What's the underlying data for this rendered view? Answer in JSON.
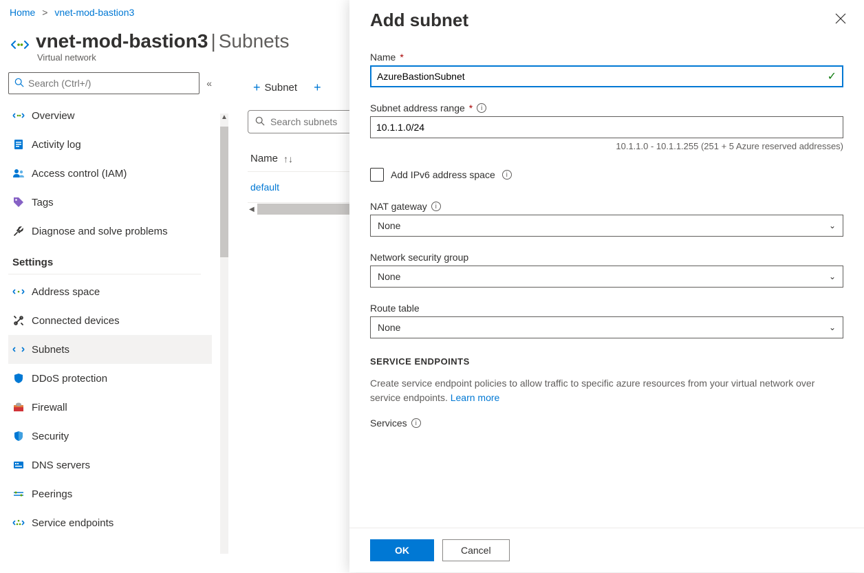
{
  "breadcrumb": {
    "home": "Home",
    "current": "vnet-mod-bastion3"
  },
  "header": {
    "title": "vnet-mod-bastion3",
    "section": "Subnets",
    "subtitle": "Virtual network"
  },
  "sidebar": {
    "search_placeholder": "Search (Ctrl+/)",
    "top_items": [
      {
        "label": "Overview"
      },
      {
        "label": "Activity log"
      },
      {
        "label": "Access control (IAM)"
      },
      {
        "label": "Tags"
      },
      {
        "label": "Diagnose and solve problems"
      }
    ],
    "settings_label": "Settings",
    "settings_items": [
      {
        "label": "Address space"
      },
      {
        "label": "Connected devices"
      },
      {
        "label": "Subnets"
      },
      {
        "label": "DDoS protection"
      },
      {
        "label": "Firewall"
      },
      {
        "label": "Security"
      },
      {
        "label": "DNS servers"
      },
      {
        "label": "Peerings"
      },
      {
        "label": "Service endpoints"
      }
    ]
  },
  "toolbar": {
    "subnet_btn": "Subnet",
    "filter_placeholder": "Search subnets"
  },
  "table": {
    "col_name": "Name",
    "row_default": "default"
  },
  "panel": {
    "title": "Add subnet",
    "name_label": "Name",
    "name_value": "AzureBastionSubnet",
    "range_label": "Subnet address range",
    "range_value": "10.1.1.0/24",
    "range_help": "10.1.1.0 - 10.1.1.255 (251 + 5 Azure reserved addresses)",
    "ipv6_label": "Add IPv6 address space",
    "nat_label": "NAT gateway",
    "nat_value": "None",
    "nsg_label": "Network security group",
    "nsg_value": "None",
    "route_label": "Route table",
    "route_value": "None",
    "endpoints_heading": "SERVICE ENDPOINTS",
    "endpoints_desc": "Create service endpoint policies to allow traffic to specific azure resources from your virtual network over service endpoints. ",
    "learn_more": "Learn more",
    "services_label": "Services",
    "ok_btn": "OK",
    "cancel_btn": "Cancel"
  }
}
